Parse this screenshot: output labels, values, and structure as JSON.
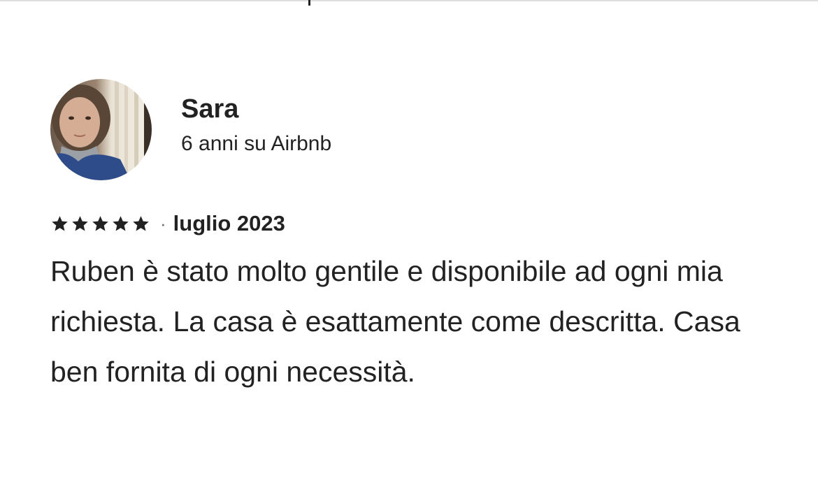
{
  "review": {
    "reviewer_name": "Sara",
    "reviewer_tenure": "6 anni su Airbnb",
    "rating": 5,
    "rating_max": 5,
    "separator": "·",
    "date": "luglio 2023",
    "text": "Ruben è stato molto gentile e disponibile ad ogni mia richiesta. La casa è esattamente come descritta. Casa ben fornita di ogni necessità."
  },
  "colors": {
    "text": "#222222",
    "secondary": "#6a6a6a",
    "background": "#ffffff",
    "divider": "#dddddd"
  },
  "icons": {
    "star": "star-icon",
    "avatar": "avatar"
  }
}
